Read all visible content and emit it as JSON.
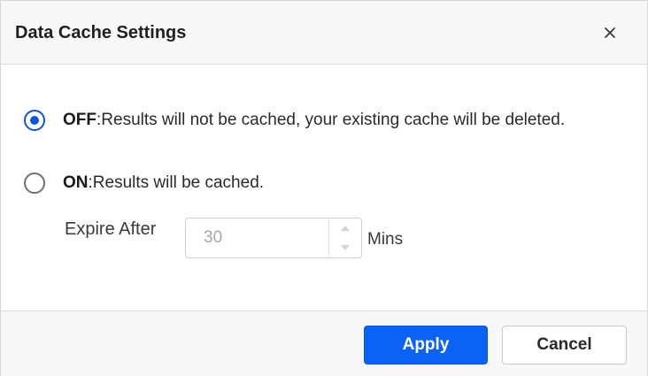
{
  "dialog": {
    "title": "Data Cache Settings",
    "close_icon": "close-icon"
  },
  "options": [
    {
      "key": "OFF",
      "description": ":Results will not be cached, your existing cache will be deleted.",
      "selected": true
    },
    {
      "key": "ON",
      "description": ":Results will be cached.",
      "selected": false
    }
  ],
  "expire": {
    "label": "Expire After",
    "value": "30",
    "unit": "Mins",
    "disabled": true
  },
  "footer": {
    "apply_label": "Apply",
    "cancel_label": "Cancel"
  },
  "colors": {
    "accent": "#0b63f6",
    "radio_selected": "#0a58d8",
    "header_bg": "#f8f8f8"
  }
}
